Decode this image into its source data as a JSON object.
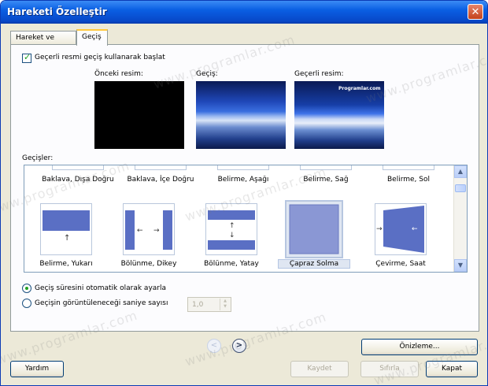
{
  "window": {
    "title": "Hareketi Özelleştir",
    "close_glyph": "✕"
  },
  "tabs": [
    {
      "label": "Hareket ve Süre",
      "active": false
    },
    {
      "label": "Geçiş",
      "active": true
    }
  ],
  "start_checkbox": {
    "label": "Geçerli resmi geçiş kullanarak başlat",
    "checked": true
  },
  "previews": {
    "previous_label": "Önceki resim:",
    "transition_label": "Geçiş:",
    "current_label": "Geçerli resim:",
    "current_overlay_text": "Programlar.com"
  },
  "transitions_label": "Geçişler:",
  "transitions": {
    "row1": [
      "Baklava, Dışa Doğru",
      "Baklava, İçe Doğru",
      "Belirme, Aşağı",
      "Belirme, Sağ",
      "Belirme, Sol"
    ],
    "row2": [
      "Belirme, Yukarı",
      "Bölünme, Dikey",
      "Bölünme, Yatay",
      "Çapraz Solma",
      "Çevirme, Saat"
    ],
    "selected": "Çapraz Solma"
  },
  "duration": {
    "auto_label": "Geçiş süresini otomatik olarak ayarla",
    "manual_label": "Geçişin görüntüleneceği saniye sayısı",
    "selected": "auto",
    "seconds_value": "1,0"
  },
  "buttons": {
    "preview": "Önizleme...",
    "help": "Yardım",
    "save": "Kaydet",
    "reset": "Sıfırla",
    "close": "Kapat"
  },
  "nav": {
    "back_glyph": "<",
    "forward_glyph": ">"
  },
  "watermark": "www.programlar.com",
  "colors": {
    "titlebar": "#0a5fe3",
    "thumb_blue": "#5a6fc4",
    "check_green": "#21a121"
  }
}
